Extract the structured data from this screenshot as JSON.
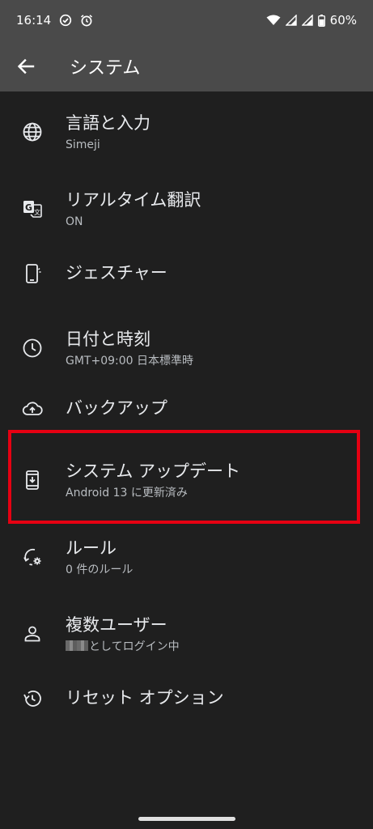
{
  "status": {
    "time": "16:14",
    "battery": "60%"
  },
  "app_bar": {
    "title": "システム"
  },
  "items": [
    {
      "title": "言語と入力",
      "subtitle": "Simeji",
      "icon": "globe-icon"
    },
    {
      "title": "リアルタイム翻訳",
      "subtitle": "ON",
      "icon": "translate-icon"
    },
    {
      "title": "ジェスチャー",
      "subtitle": "",
      "icon": "gesture-phone-icon"
    },
    {
      "title": "日付と時刻",
      "subtitle": "GMT+09:00 日本標準時",
      "icon": "clock-icon"
    },
    {
      "title": "バックアップ",
      "subtitle": "",
      "icon": "cloud-upload-icon"
    },
    {
      "title": "システム アップデート",
      "subtitle": "Android 13 に更新済み",
      "icon": "system-update-icon"
    },
    {
      "title": "ルール",
      "subtitle": "0 件のルール",
      "icon": "rules-icon"
    },
    {
      "title": "複数ユーザー",
      "subtitle": "としてログイン中",
      "icon": "person-icon"
    },
    {
      "title": "リセット オプション",
      "subtitle": "",
      "icon": "history-icon"
    }
  ],
  "colors": {
    "background": "#1f1f1f",
    "app_bar": "#4a4a4a",
    "highlight": "#e60012"
  }
}
